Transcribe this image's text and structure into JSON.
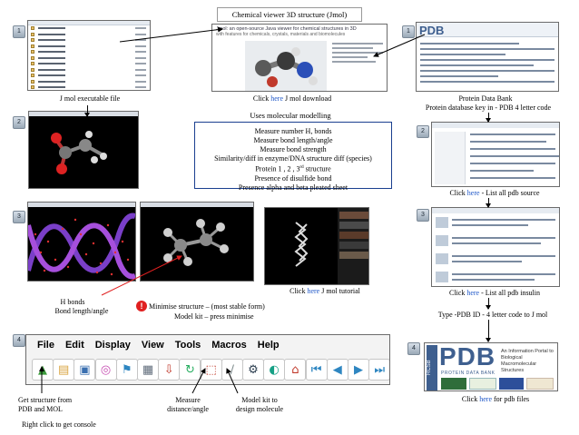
{
  "title": "Chemical viewer 3D structure (Jmol)",
  "steps": [
    "1",
    "1",
    "2",
    "2",
    "3",
    "3",
    "4",
    "4"
  ],
  "captions": {
    "jmol_exe": "J mol executable file",
    "download_pre": "Click ",
    "download_here": "here",
    "download_post": " J mol download",
    "pdb_line1": "Protein Data Bank",
    "pdb_line2": "Protein database key in - PDB  4 letter code",
    "pdb_source_pre": "Click ",
    "pdb_source_here": "here",
    "pdb_source_post": " - List all pdb source",
    "pdb_insulin_pre": "Click ",
    "pdb_insulin_here": "here",
    "pdb_insulin_post": " - List all pdb insulin",
    "pdb_files_pre": "Click ",
    "pdb_files_here": "here",
    "pdb_files_post": " for pdb files",
    "tutorial_pre": "Click ",
    "tutorial_here": "here",
    "tutorial_post": " J mol tutorial",
    "hbonds_line1": "H bonds",
    "hbonds_line2": "Bond length/angle",
    "minimise_line1": "Minimise structure – (most stable form)",
    "minimise_line2": "Model kit – press minimise",
    "type_pdb": "Type -PDB ID - 4 letter code to J mol",
    "get_structure_line1": "Get structure from",
    "get_structure_line2": "PDB and MOL",
    "right_click": "Right click to get console",
    "measure_line1": "Measure",
    "measure_line2": "distance/angle",
    "modelkit_line1": "Model kit to",
    "modelkit_line2": "design molecule"
  },
  "modelling": {
    "heading": "Uses molecular modelling",
    "items": [
      "Measure number H, bonds",
      "Measure bond length/angle",
      "Measure bond strength",
      "Similarity/diff in enzyme/DNA structure diff (species)",
      "Protein 1 , 2 , 3",
      "Presence of disulfide bond",
      "Presence alpha and beta pleated sheet"
    ],
    "protein_suffix_sup": "rd",
    "protein_suffix": " structure"
  },
  "jmol_site": {
    "headline": "Jmol: an open-source Java viewer for chemical structures in 3D",
    "subline": "with features for chemicals, crystals, materials and biomolecules"
  },
  "pdb_logo": {
    "letters": "PDB",
    "side": "RCSB",
    "sub": "PROTEIN DATA BANK",
    "tagline_1": "An Information Portal to",
    "tagline_2": "Biological Macromolecular Structures"
  },
  "toolbar": {
    "menus": [
      "File",
      "Edit",
      "Display",
      "View",
      "Tools",
      "Macros",
      "Help"
    ],
    "buttons": [
      {
        "name": "open-file-icon",
        "color": "#3b9a3b"
      },
      {
        "name": "open-folder-icon",
        "color": "#d9a441"
      },
      {
        "name": "save-icon",
        "color": "#3a6fb0"
      },
      {
        "name": "cd-icon",
        "color": "#c74fb3"
      },
      {
        "name": "lookup-icon",
        "color": "#2e86c1"
      },
      {
        "name": "print-icon",
        "color": "#5f6b7a"
      },
      {
        "name": "export-icon",
        "color": "#c0392b"
      },
      {
        "name": "rotate-icon",
        "color": "#27ae60"
      },
      {
        "name": "select-icon",
        "color": "#c0392b"
      },
      {
        "name": "measure-icon",
        "color": "#7f8c8d"
      },
      {
        "name": "model-kit-icon",
        "color": "#2c3e50"
      },
      {
        "name": "spin-icon",
        "color": "#16a085"
      },
      {
        "name": "home-icon",
        "color": "#c0392b"
      },
      {
        "name": "first-frame-icon",
        "color": "#2e86c1"
      },
      {
        "name": "previous-frame-icon",
        "color": "#2e86c1"
      },
      {
        "name": "next-frame-icon",
        "color": "#2e86c1"
      },
      {
        "name": "last-frame-icon",
        "color": "#2e86c1"
      }
    ]
  },
  "colors": {
    "link": "#1f57c8",
    "accent_red": "#e02020",
    "pdb_blue": "#3e5f8f"
  }
}
